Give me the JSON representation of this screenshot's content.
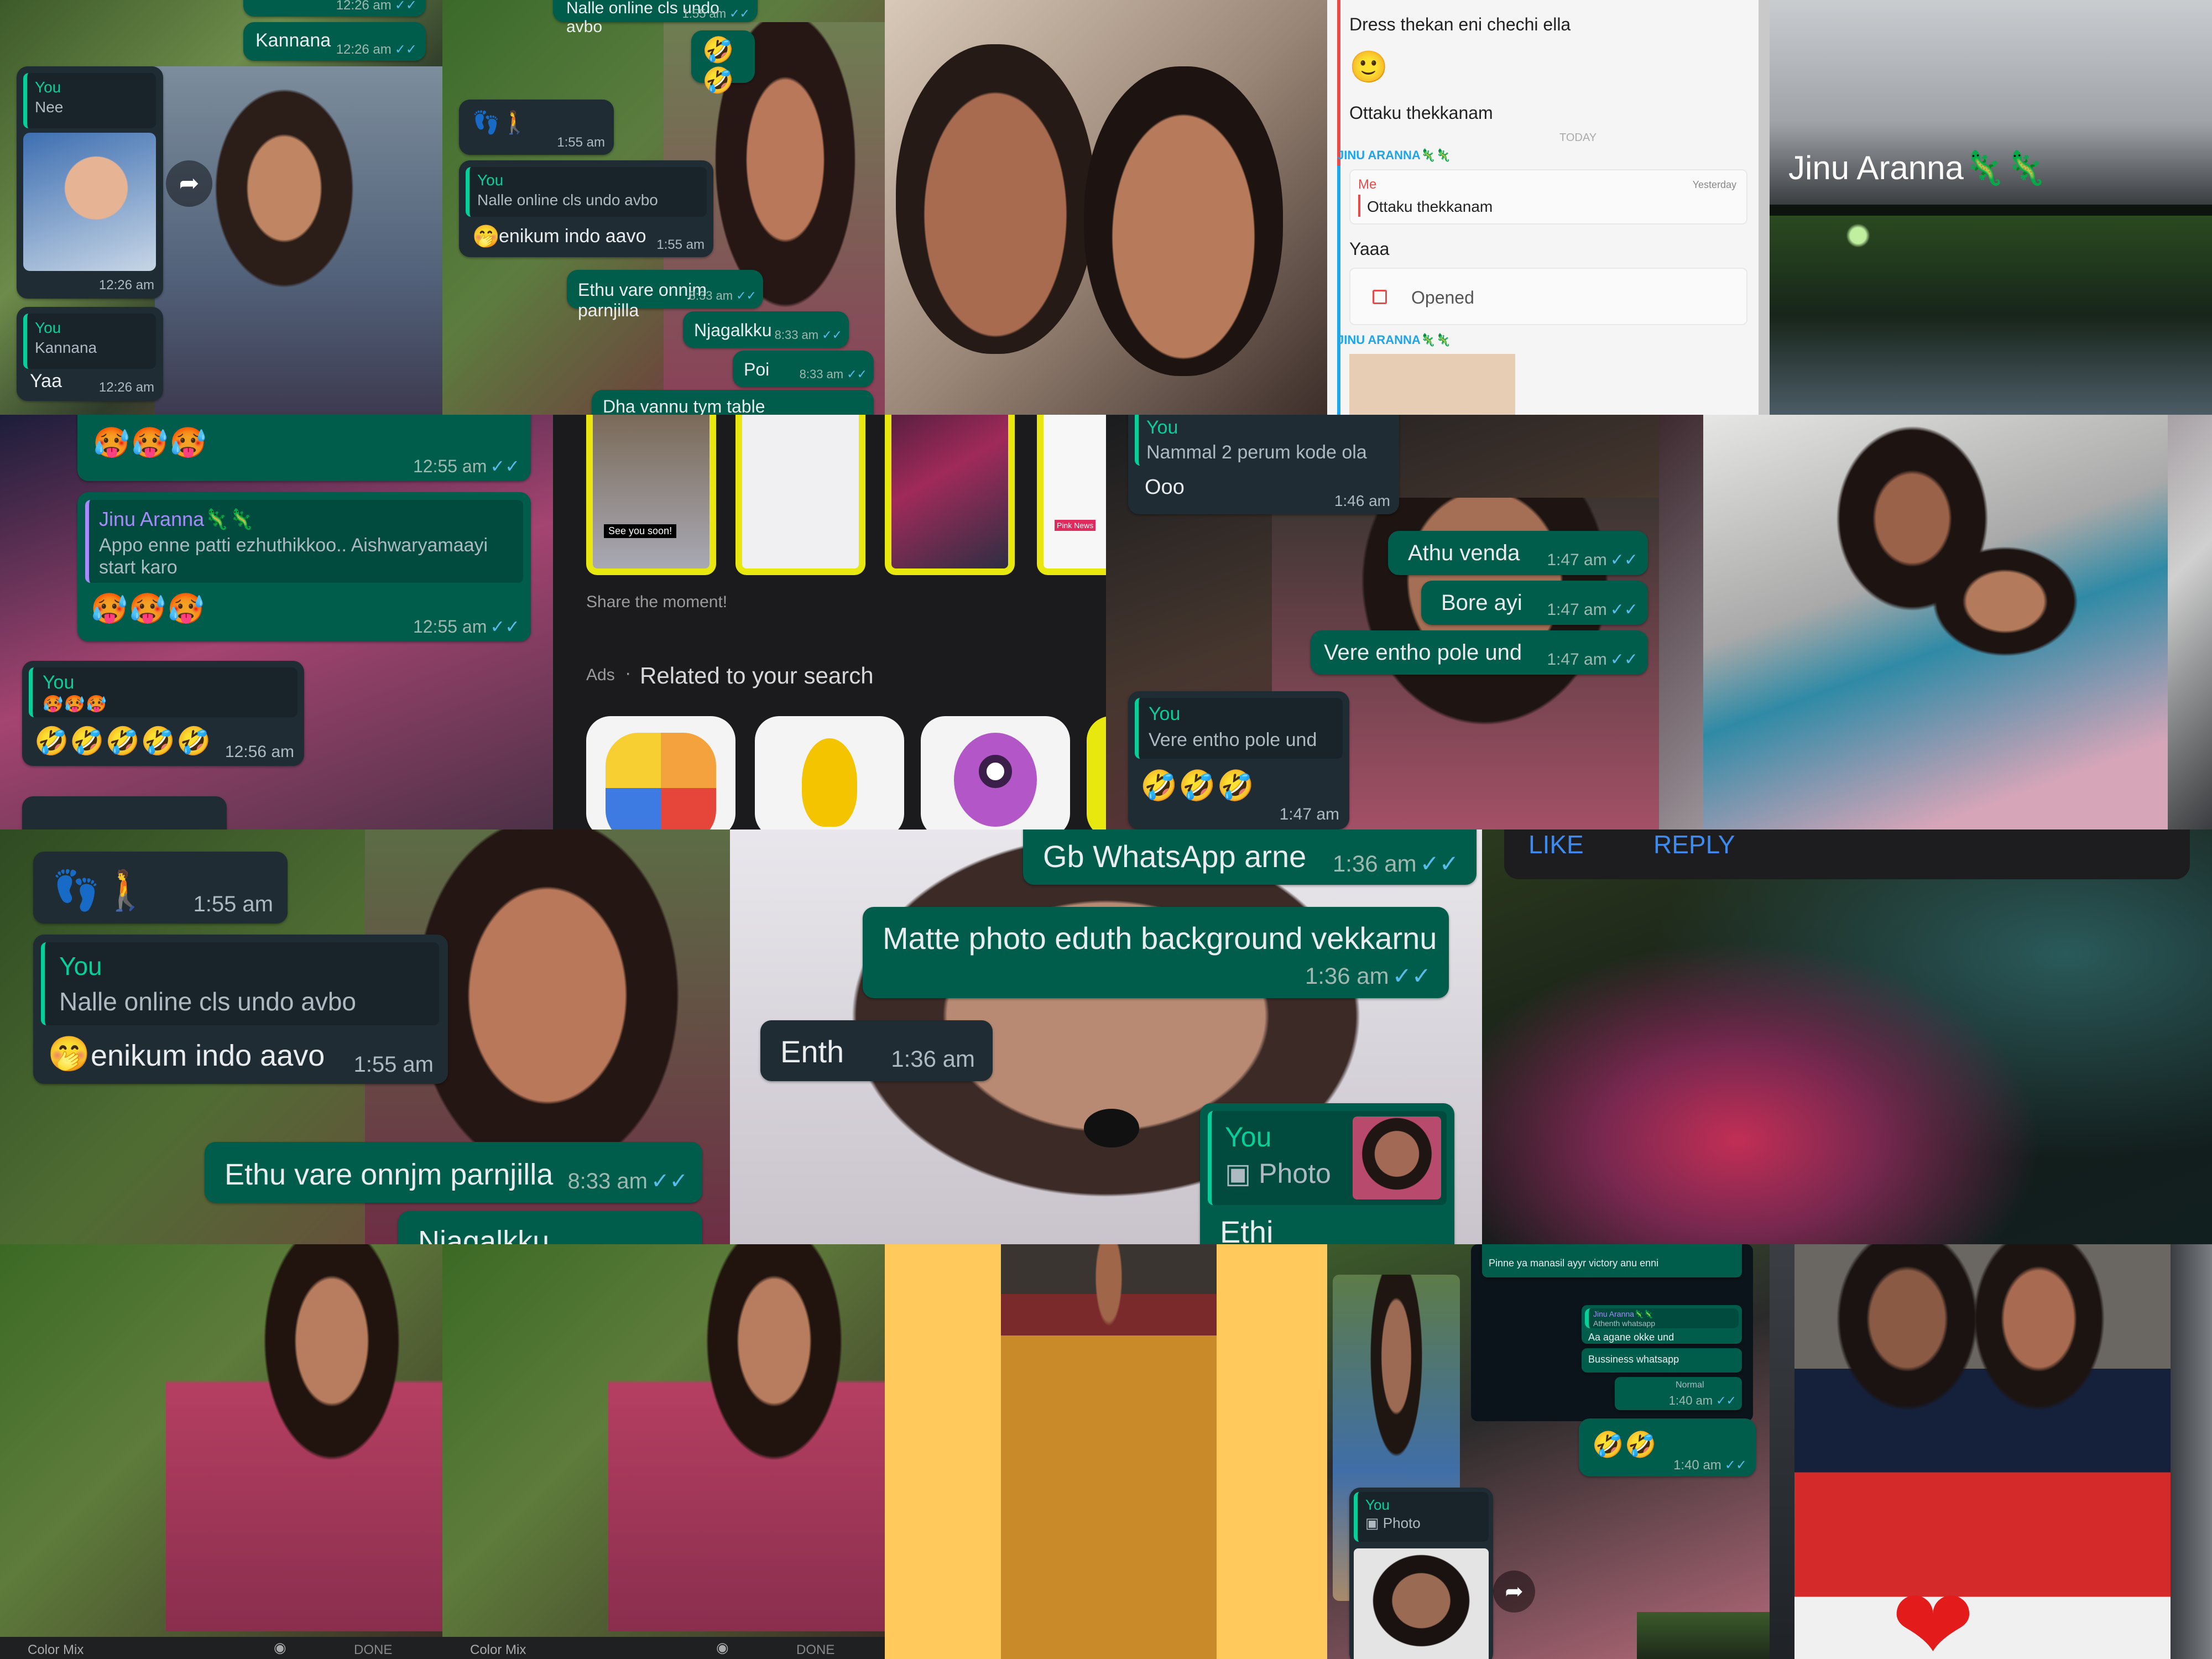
{
  "colors": {
    "out_bubble": "#005c4b",
    "in_bubble": "#1f2c34",
    "quote_green": "#06cf9c",
    "read_tick": "#53bdeb",
    "snap_yellow": "#fffc00"
  },
  "emoji": {
    "sad3": "🥵🥵🥵",
    "rofl2": "🤣🤣",
    "rofl3": "🤣🤣🤣",
    "rofl5": "🤣🤣🤣🤣🤣",
    "sweat": "🥲",
    "footprints": "👣🚶",
    "shh": "🤭",
    "blush": "🙂",
    "plants": "🦎🦎",
    "heart": "❤"
  },
  "t1": {
    "kannana": "Kannana",
    "t_kannana": "12:26 am",
    "you": "You",
    "nee": "Nee",
    "t_photo": "12:26 am",
    "you2": "You",
    "kannana2": "Kannana",
    "yaa": "Yaa",
    "t_yaa": "12:26 am",
    "t_top": "12:26 am"
  },
  "t2": {
    "top": "Nalle online cls undo avbo",
    "t_top": "1:55 am",
    "t_emoji": "1:55 am",
    "t_feet": "1:55 am",
    "you": "You",
    "quote": "Nalle online cls undo avbo",
    "reply": "enikum indo aavo",
    "t_reply": "1:55 am",
    "m1": "Ethu vare onnjm parnjilla",
    "t1": "8:33 am",
    "m2": "Njagalkku",
    "t2": "8:33 am",
    "m3": "Poi",
    "t3": "8:33 am",
    "m4": "Dha vannu tym table"
  },
  "t4": {
    "l1": "Dress thekan eni chechi ella",
    "l2": "Ottaku thekkanam",
    "today": "TODAY",
    "sender": "JINU ARANNA",
    "me": "Me",
    "yesterday": "Yesterday",
    "quote": "Ottaku thekkanam",
    "yaaa": "Yaaa",
    "opened": "Opened",
    "sender2": "JINU ARANNA"
  },
  "t5": {
    "name": "Jinu Aranna"
  },
  "t6": {
    "t1": "12:55 am",
    "name": "Jinu Aranna",
    "quote": "Appo enne patti ezhuthikkoo.. Aishwaryamaayi start karo",
    "t2": "12:55 am",
    "you": "You",
    "t3": "12:56 am"
  },
  "t7": {
    "share": "Share the moment!",
    "ads": "Ads",
    "related": "Related to your search",
    "snap_caption": "See you soon!",
    "pink": "Pink News"
  },
  "t8": {
    "you": "You",
    "quote": "Nammal 2 perum kode ola",
    "ooo": "Ooo",
    "t_ooo": "1:46 am",
    "m1": "Athu venda",
    "t1": "1:47 am",
    "m2": "Bore ayi",
    "t2": "1:47 am",
    "m3": "Vere entho pole und",
    "t3": "1:47 am",
    "you2": "You",
    "quote2": "Vere entho pole und",
    "t4": "1:47 am"
  },
  "t10": {
    "t_feet": "1:55 am",
    "you": "You",
    "quote": "Nalle online cls undo avbo",
    "reply": "enikum indo aavo",
    "t_reply": "1:55 am",
    "m1": "Ethu vare onnjm parnjilla",
    "t1": "8:33 am",
    "m2": "Niagalkku"
  },
  "t11": {
    "m1": "Gb WhatsApp arne",
    "t1": "1:36 am",
    "m2": "Matte photo eduth background vekkarnu",
    "t2": "1:36 am",
    "enth": "Enth",
    "t3": "1:36 am",
    "you": "You",
    "photo": "Photo",
    "ethi": "Ethi",
    "t4": "1:36 am"
  },
  "t12": {
    "like": "LIKE",
    "reply": "REPLY"
  },
  "t13": {
    "colormix": "Color Mix",
    "done": "DONE"
  },
  "t14": {
    "colormix": "Color Mix",
    "done": "DONE"
  },
  "t16": {
    "line1": "Pinne ya manasil ayyr victory anu enni",
    "qname": "Jinu Aranna",
    "qtext": "Athenth whatsapp",
    "l2": "Aa agane okke und",
    "l3": "Bussiness whatsapp",
    "t1": "1:40 am",
    "t2": "1:40 am",
    "you": "You",
    "photo": "Photo",
    "normal": "Normal"
  }
}
